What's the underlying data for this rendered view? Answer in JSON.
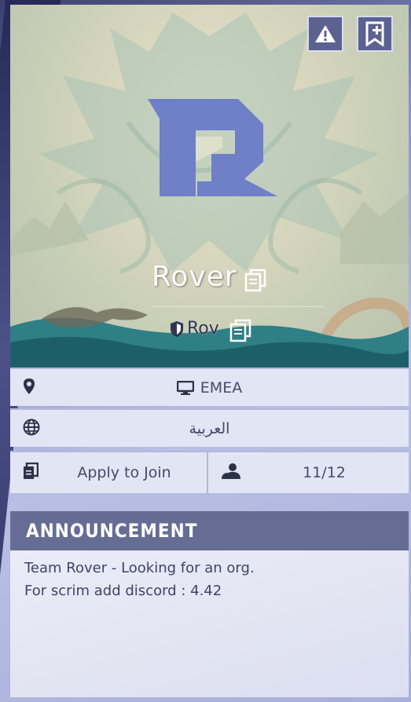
{
  "team": {
    "name": "Rover",
    "tag": "Rov",
    "logo_letter": "R"
  },
  "info": {
    "region": "EMEA",
    "language": "العربية",
    "join_mode": "Apply to Join",
    "members": "11/12"
  },
  "announcement": {
    "title": "ANNOUNCEMENT",
    "lines": [
      "Team Rover - Looking for an org.",
      "For scrim add discord : 4.42"
    ]
  },
  "icons": {
    "report": "warning-icon",
    "bookmark": "bookmark-add-icon",
    "copy": "copy-icon",
    "location": "location-pin-icon",
    "platform": "monitor-icon",
    "language": "globe-icon",
    "join": "document-stack-icon",
    "members": "users-icon",
    "tag": "shield-icon"
  },
  "colors": {
    "logo": "#6f7fc8",
    "header_bar": "#666d95",
    "row_bg": "#e2e5f4",
    "button_bg": "#5b6290"
  }
}
